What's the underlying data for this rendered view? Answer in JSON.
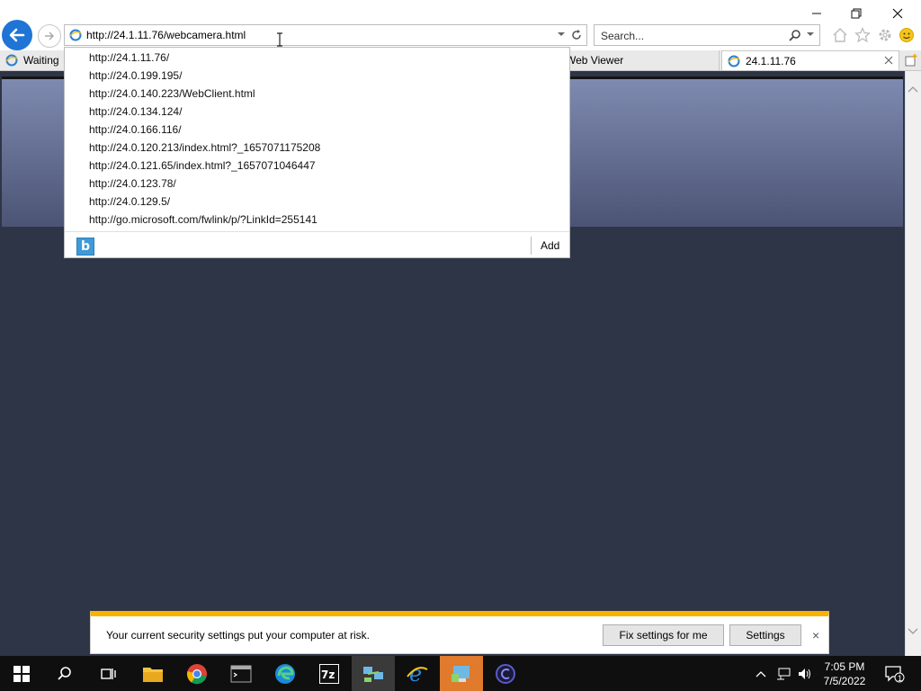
{
  "browser": {
    "address_url": "http://24.1.11.76/webcamera.html",
    "search_placeholder": "Search...",
    "tabs": [
      {
        "label": "Waiting"
      },
      {
        "label": "Web Viewer"
      },
      {
        "label": "24.1.11.76"
      }
    ]
  },
  "autocomplete": {
    "items": [
      "http://24.1.11.76/",
      "http://24.0.199.195/",
      "http://24.0.140.223/WebClient.html",
      "http://24.0.134.124/",
      "http://24.0.166.116/",
      "http://24.0.120.213/index.html?_1657071175208",
      "http://24.0.121.65/index.html?_1657071046447",
      "http://24.0.123.78/",
      "http://24.0.129.5/",
      "http://go.microsoft.com/fwlink/p/?LinkId=255141"
    ],
    "bing_label": "b",
    "add_label": "Add"
  },
  "security_bar": {
    "message": "Your current security settings put your computer at risk.",
    "fix_button": "Fix settings for me",
    "settings_button": "Settings",
    "close": "×"
  },
  "taskbar": {
    "time": "7:05 PM",
    "date": "7/5/2022",
    "notification_count": "1"
  },
  "colors": {
    "accent": "#1f74d6",
    "warning": "#f7b300",
    "content_bg": "#2e3547"
  }
}
